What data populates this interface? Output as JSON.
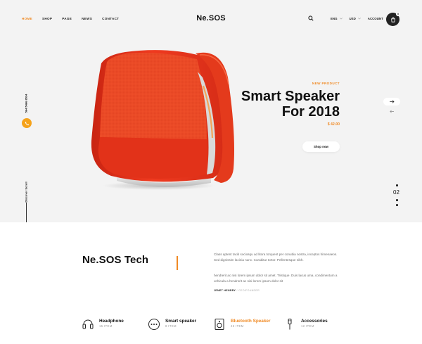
{
  "header": {
    "nav": [
      "HOME",
      "SHOP",
      "PAGE",
      "NEWS",
      "CONTACT"
    ],
    "logo": "Ne.SOS",
    "currency_lang": "ENG",
    "currency": "USD",
    "account": "ACCOUNT",
    "cart_count": "0"
  },
  "left_rail": {
    "phone": "564 5466 8534",
    "discover": "Discover Scroll"
  },
  "hero": {
    "eyebrow": "NEW PRODUCT",
    "title_line1": "Smart Speaker",
    "title_line2": "For 2018",
    "price": "$ 42.00",
    "button": "Shop now",
    "slide_number": "02"
  },
  "about": {
    "brand": "Ne.SOS Tech",
    "paragraph1": "Class aptent taciti sociosqu ad litora torquent per conubia nostra, inceptos himenaeos. Sed dignissim lacinia nunc. Curabitur tortor. Pellentesque nibh.",
    "paragraph2": "hendrerit ac nisi lorem ipsum dolor sit amet. Tristique. Duis lacus uma, condimentum a vehicula a hendrerit ac nisi lorem ipsum dolor sit",
    "author": "JENET HENRRY",
    "author_sep": " / ",
    "author_role": "CEO/FOUNDER"
  },
  "categories": [
    {
      "name": "Headphone",
      "count": "15 ITEM",
      "icon": "headphone-icon"
    },
    {
      "name": "Smart speaker",
      "count": "8 ITEM",
      "icon": "smart-speaker-icon"
    },
    {
      "name": "Bluetooth Speaker",
      "count": "45 ITEM",
      "icon": "bluetooth-speaker-icon"
    },
    {
      "name": "Accessories",
      "count": "12 ITEM",
      "icon": "accessories-icon"
    }
  ],
  "colors": {
    "accent": "#f08a24",
    "phone_button": "#f5a21a",
    "hero_bg": "#f3f3f3",
    "speaker_red": "#e8361c"
  }
}
